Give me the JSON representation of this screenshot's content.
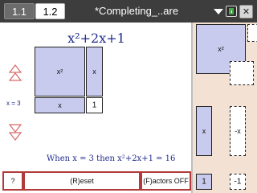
{
  "topbar": {
    "tabs": [
      {
        "label": "1.1"
      },
      {
        "label": "1.2"
      }
    ],
    "document_title": "*Completing_..are",
    "icons": [
      "dropdown-icon",
      "battery-icon",
      "close-icon"
    ],
    "colors": {
      "background": "#3d3d3d",
      "active_tab": "#ffffff",
      "inactive_tab": "#6c6c6c"
    }
  },
  "canvas": {
    "equation": "x²+2x+1",
    "tiles": {
      "big_square": "x²",
      "right_rect": "x",
      "bottom_rect": "x",
      "unit_square": "1"
    },
    "x_value_label": "x = 3",
    "result": "When x = 3 then x²+2x+1 = 16",
    "colors": {
      "tile_fill": "#c8cbed",
      "text": "#1f2a8c"
    }
  },
  "buttons": {
    "help": "?",
    "reset": "(R)eset",
    "factors": "(F)actors OFF",
    "colors": {
      "border": "#b33a3a"
    }
  },
  "side_panel": {
    "tiles": {
      "x_squared": "x²",
      "x": "x",
      "neg_x": "-x",
      "one": "1",
      "neg_one": "-1"
    },
    "colors": {
      "background": "#f3e1d3"
    }
  }
}
